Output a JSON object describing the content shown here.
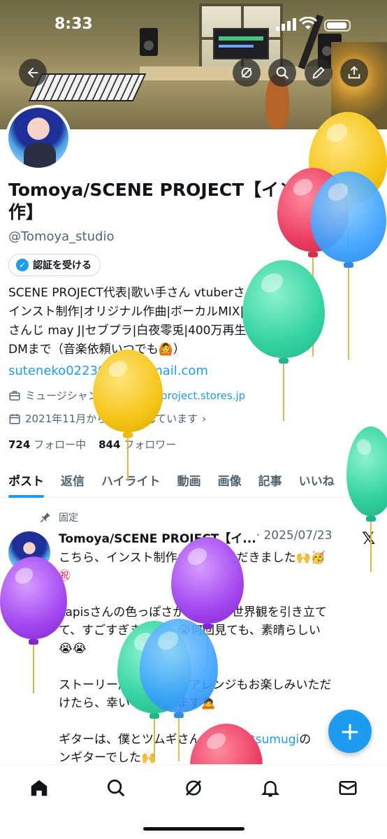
{
  "status_bar": {
    "time": "8:33"
  },
  "header_actions": [
    "back-icon",
    "grok-icon",
    "search-icon",
    "edit-icon",
    "share-icon"
  ],
  "profile": {
    "name": "Tomoya/SCENE PROJECT【インスト制作】",
    "name_line1": "Tomoya/SCENE PROJECT【インスト制",
    "name_line2": "作】",
    "handle": "@Tomoya_studio",
    "verify_label": "認証を受ける",
    "bio_lines": [
      "SCENE PROJECT代表|歌い手さん vtuberさん応援します|",
      "インスト制作|オリジナル作曲|ボーカルMIX|めておら|にじ",
      "さんじ may J|セブプラ|白夜零兎|400万再生達成|ご依頼は",
      "DMまで（音楽依頼いつでも🙆）"
    ],
    "email": "suteneko02230426@gmail.com",
    "category": "ミュージシャン",
    "website": "scene-project.stores.jp",
    "joined": "2021年11月からXを利用しています",
    "following_count": "724",
    "following_label": "フォロー中",
    "followers_count": "844",
    "followers_label": "フォロワー"
  },
  "tabs": [
    "ポスト",
    "返信",
    "ハイライト",
    "動画",
    "画像",
    "記事",
    "いいね"
  ],
  "active_tab": "ポスト",
  "post": {
    "pinned_label": "固定",
    "author": "Tomoya/SCENE PROJECT【イ...",
    "date": "· 2025/07/23",
    "lines": [
      "こちら、インスト制作させていただきました🙌🥳",
      "㊗",
      "",
      "Lapisさんの色っぽさが、楽曲の世界観を引き立て",
      "て、すごすぎます…！😭何回見ても、素晴らしい",
      "😭😭",
      "",
      "ストーリー展開していくアレンジもお楽しみいただ",
      "けたら、幸いでございます🙇",
      "",
      "ギターは、僕とツムギさん"
    ],
    "mention": "@ateliertsumugi",
    "mention_tail": "の",
    "last_line": "ンギターでした🙌"
  },
  "fab_label": "+",
  "bottom_nav": [
    "home-icon",
    "search-icon",
    "grok-icon",
    "notifications-icon",
    "messages-icon"
  ],
  "colors": {
    "accent": "#1d9bf0",
    "text": "#0f1419",
    "muted": "#536471"
  }
}
